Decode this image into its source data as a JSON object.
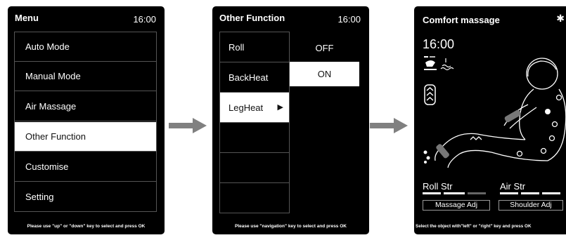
{
  "menu_screen": {
    "title": "Menu",
    "time": "16:00",
    "items": [
      "Auto Mode",
      "Manual Mode",
      "Air Massage",
      "Other Function",
      "Customise",
      "Setting"
    ],
    "selected_item": "Other Function",
    "hint": "Please use \"up\" or \"down\" key to select and press OK"
  },
  "other_function_screen": {
    "title": "Other Function",
    "time": "16:00",
    "options": [
      {
        "label": "Roll",
        "value": "OFF"
      },
      {
        "label": "BackHeat",
        "value": "ON"
      },
      {
        "label": "LegHeat",
        "value": ""
      }
    ],
    "selected_option": "LegHeat",
    "selected_value": "ON",
    "hint": "Please use \"navigation\" key to select and press OK"
  },
  "comfort_screen": {
    "title": "Comfort massage",
    "time": "16:00",
    "roll_str_label": "Roll Str",
    "air_str_label": "Air Str",
    "massage_adj_button": "Massage Adj",
    "shoulder_adj_button": "Shoulder Adj",
    "hint": "Select the object with\"left\" or \"right\" key and press OK",
    "icons": [
      "bluetooth-icon",
      "foot-roller-icon",
      "heat-icon",
      "air-bag-icon",
      "massage-chair-figure"
    ]
  },
  "colors": {
    "screen_bg": "#000000",
    "selection_bg": "#ffffff",
    "arrow": "#808080"
  }
}
